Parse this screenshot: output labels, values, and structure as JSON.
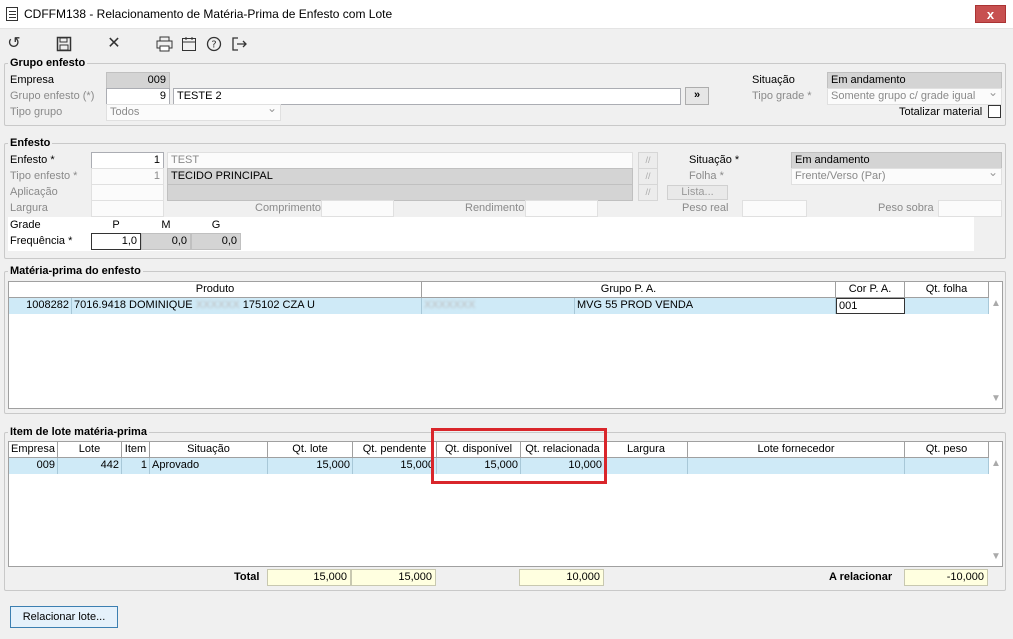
{
  "window": {
    "title": "CDFFM138 - Relacionamento de Matéria-Prima de Enfesto com Lote",
    "close": "x"
  },
  "toolbar": [
    "undo-icon",
    "save-icon",
    "cancel-icon",
    "print-icon",
    "calendar-icon",
    "help-icon",
    "exit-icon"
  ],
  "grupo_enfesto": {
    "title": "Grupo enfesto",
    "empresa_label": "Empresa",
    "empresa": "009",
    "grupo_label": "Grupo enfesto (*)",
    "grupo_num": "9",
    "grupo_nome": "TESTE 2",
    "goto": "»",
    "tipo_grupo_label": "Tipo grupo",
    "tipo_grupo": "Todos",
    "situacao_label": "Situação",
    "situacao": "Em andamento",
    "tipo_grade_label": "Tipo grade *",
    "tipo_grade": "Somente grupo c/ grade igual",
    "totalizar_label": "Totalizar material"
  },
  "enfesto": {
    "title": "Enfesto",
    "enfesto_label": "Enfesto *",
    "enfesto_num": "1",
    "enfesto_nome": "TEST",
    "tipo_label": "Tipo enfesto *",
    "tipo_num": "1",
    "tipo_nome": "TECIDO PRINCIPAL",
    "aplicacao_label": "Aplicação",
    "largura_label": "Largura",
    "comprimento_label": "Comprimento",
    "rendimento_label": "Rendimento",
    "peso_real_label": "Peso real",
    "peso_sobra_label": "Peso sobra",
    "situacao_label": "Situação *",
    "situacao": "Em andamento",
    "folha_label": "Folha *",
    "folha": "Frente/Verso (Par)",
    "lista_label": "Lista...",
    "grade_label": "Grade",
    "frequencia_label": "Frequência *",
    "sizes": [
      "P",
      "M",
      "G"
    ],
    "freq": [
      "1,0",
      "0,0",
      "0,0"
    ]
  },
  "materia_prima": {
    "title": "Matéria-prima do enfesto",
    "headers": [
      "Produto",
      "Grupo P. A.",
      "Cor P. A.",
      "Qt. folha"
    ],
    "row": {
      "codigo": "1008282",
      "produto": "7016.9418 DOMINIQUE",
      "produto_blur": "XXXXXX",
      "produto_end": "175102 CZA U",
      "grupo_blur": "XXXXXXX",
      "grupo": "MVG 55 PROD VENDA",
      "cor": "001",
      "qt_folha": ""
    }
  },
  "lote": {
    "title": "Item de lote matéria-prima",
    "headers": [
      "Empresa",
      "Lote",
      "Item",
      "Situação",
      "Qt. lote",
      "Qt. pendente",
      "Qt. disponível",
      "Qt. relacionada",
      "Largura",
      "Lote fornecedor",
      "Qt. peso"
    ],
    "row": [
      "009",
      "442",
      "1",
      "Aprovado",
      "15,000",
      "15,000",
      "15,000",
      "10,000",
      "",
      "",
      ""
    ],
    "total_label": "Total",
    "total_qt_lote": "15,000",
    "total_pendente": "15,000",
    "total_relacionada": "10,000",
    "a_relacionar_label": "A relacionar",
    "a_relacionar": "-10,000"
  },
  "footer": {
    "relacionar_btn": "Relacionar lote..."
  },
  "colors": {
    "selection": "#cfeaf7",
    "highlight": "#d9262b",
    "yellow": "#ffffe0"
  }
}
